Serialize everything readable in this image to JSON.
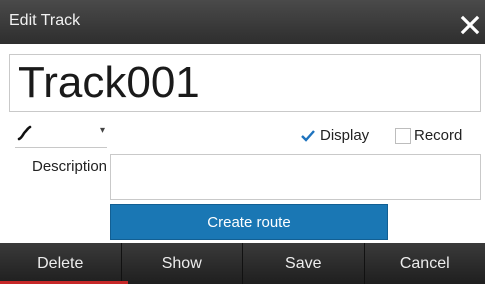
{
  "dialog": {
    "title": "Edit Track",
    "close_icon": "close-icon"
  },
  "track_name": "Track001",
  "track_style": {
    "icon": "track-line-style-icon",
    "arrow": "▾"
  },
  "options": {
    "display_label": "Display",
    "display_checked": true,
    "record_label": "Record",
    "record_checked": false
  },
  "description": {
    "label": "Description",
    "value": ""
  },
  "create_route_label": "Create route",
  "bottom_bar": {
    "delete_label": "Delete",
    "show_label": "Show",
    "save_label": "Save",
    "cancel_label": "Cancel"
  },
  "colors": {
    "accent_blue": "#1a77b4",
    "check_blue": "#1e73be",
    "red_accent": "#c62828"
  }
}
